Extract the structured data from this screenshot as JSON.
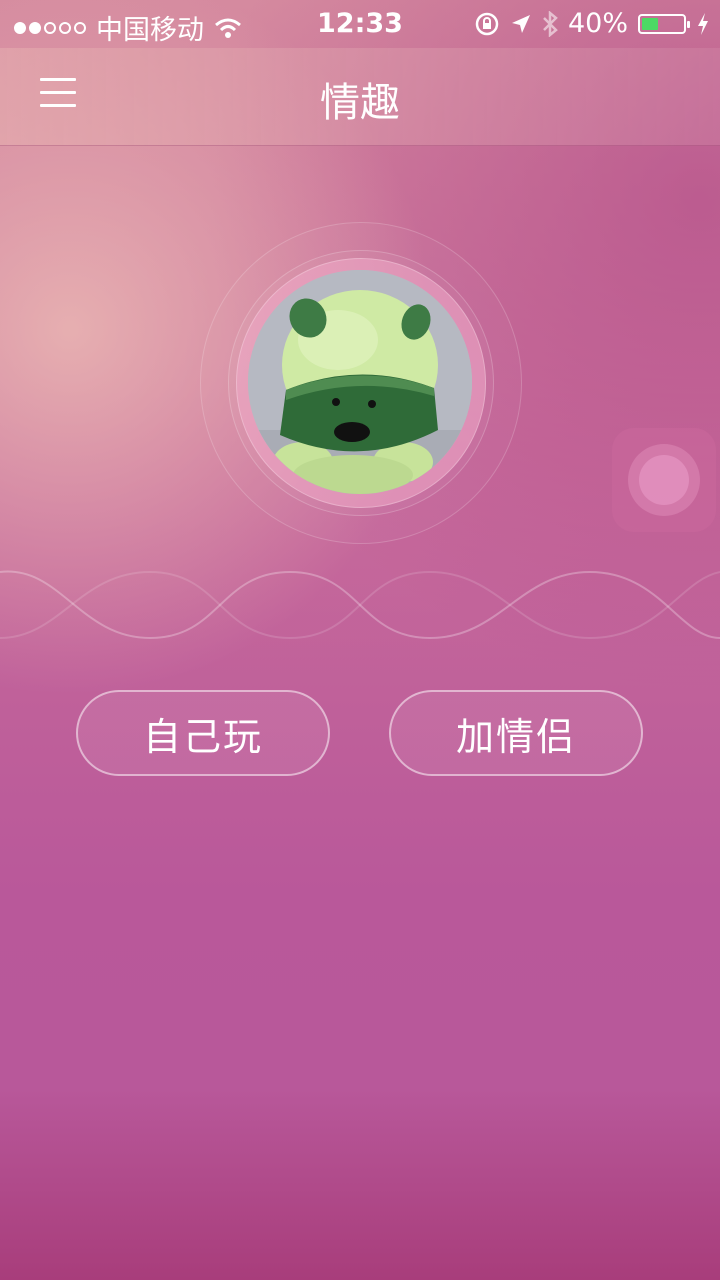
{
  "status_bar": {
    "signal_dots_filled": 2,
    "signal_dots_total": 5,
    "carrier": "中国移动",
    "time": "12:33",
    "battery_text": "40%",
    "battery_level": 0.4,
    "icons": [
      "wifi-icon",
      "orientation-lock-icon",
      "location-icon",
      "bluetooth-icon",
      "battery-icon",
      "charging-icon"
    ]
  },
  "navbar": {
    "title": "情趣",
    "menu_icon": "hamburger-menu-icon"
  },
  "actions": {
    "solo_label": "自己玩",
    "partner_label": "加情侣"
  },
  "colors": {
    "background_top": "#d58a9f",
    "background_bottom": "#b8589a",
    "battery_green": "#4cd964",
    "text": "#ffffff"
  }
}
